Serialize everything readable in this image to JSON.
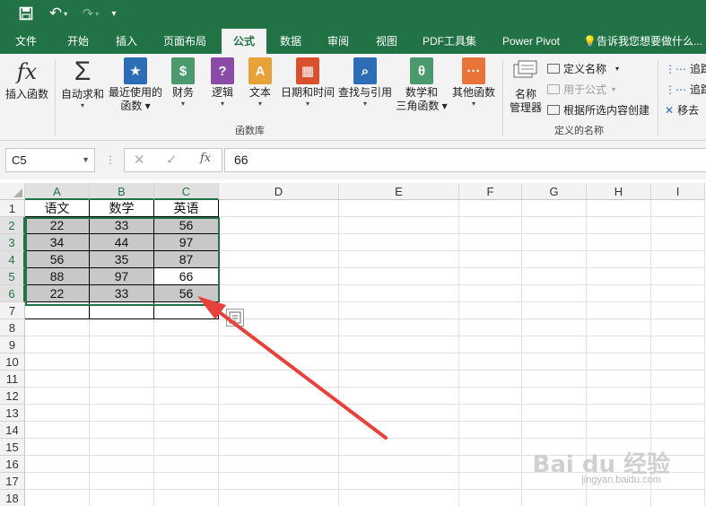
{
  "qat": {
    "undo_label": "↶",
    "more_label": "▾"
  },
  "tabs": [
    "文件",
    "开始",
    "插入",
    "页面布局",
    "公式",
    "数据",
    "审阅",
    "视图",
    "PDF工具集",
    "Power Pivot"
  ],
  "tell_me": "告诉我您想要做什么...",
  "ribbon": {
    "insert_function": "插入函数",
    "autosum": "自动求和",
    "recent": "最近使用的\n函数",
    "financial": "财务",
    "logical": "逻辑",
    "text": "文本",
    "datetime": "日期和时间",
    "lookup": "查找与引用",
    "math": "数学和\n三角函数",
    "more_functions": "其他函数",
    "group_function_library": "函数库",
    "name_manager": "名称\n管理器",
    "define_name": "定义名称",
    "use_in_formula": "用于公式",
    "create_from_selection": "根据所选内容创建",
    "group_defined_names": "定义的名称",
    "trace_precedents": "追踪",
    "trace_dependents": "追踪",
    "remove_arrows": "移去"
  },
  "formula_bar": {
    "name_box": "C5",
    "fx_label": "fx",
    "value": "66"
  },
  "columns": [
    "A",
    "B",
    "C",
    "D",
    "E",
    "F",
    "G",
    "H",
    "I"
  ],
  "rows": [
    "1",
    "2",
    "3",
    "4",
    "5",
    "6",
    "7",
    "8",
    "9",
    "10",
    "11",
    "12",
    "13",
    "14",
    "15",
    "16",
    "17",
    "18"
  ],
  "sheet": {
    "header": [
      "语文",
      "数学",
      "英语"
    ],
    "data": [
      [
        "22",
        "33",
        "56"
      ],
      [
        "34",
        "44",
        "97"
      ],
      [
        "56",
        "35",
        "87"
      ],
      [
        "88",
        "97",
        "66"
      ],
      [
        "22",
        "33",
        "56"
      ]
    ]
  },
  "colors": {
    "excel_green": "#217346",
    "arrow_red": "#e8403b",
    "selected_fill": "#c8c8c8"
  },
  "watermark": {
    "main": "Bai du 经验",
    "sub": "jingyan.baidu.com"
  }
}
